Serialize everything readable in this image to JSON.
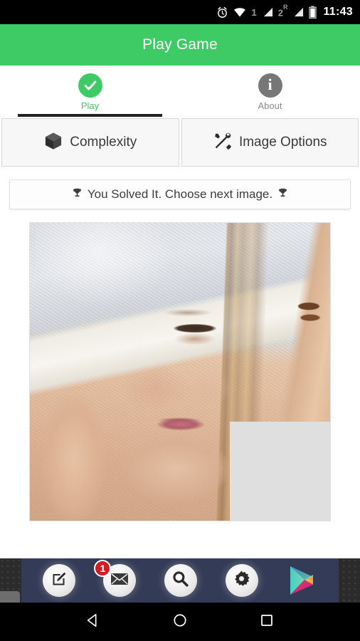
{
  "statusbar": {
    "icons": [
      "alarm-clock-icon",
      "wifi-icon",
      "signal-1-icon",
      "signal-2-roaming-icon",
      "battery-icon"
    ],
    "sim1_label": "1",
    "sim2_label": "2",
    "roaming_label": "R",
    "time": "11:43"
  },
  "appbar": {
    "title": "Play Game"
  },
  "tabs": [
    {
      "label": "Play",
      "icon": "check-circle-icon",
      "selected": true,
      "color": "#3ecb65"
    },
    {
      "label": "About",
      "icon": "info-circle-icon",
      "selected": false,
      "color": "#777777"
    }
  ],
  "options": [
    {
      "label": "Complexity",
      "icon": "cube-icon"
    },
    {
      "label": "Image Options",
      "icon": "tools-icon"
    }
  ],
  "status_card": {
    "text": "You Solved It. Choose next image.",
    "left_icon": "trophy-icon",
    "right_icon": "trophy-icon",
    "trophy_glyph": "🏆"
  },
  "puzzle": {
    "description": "Woman wearing a white knit cap, blonde hair, brown hair tie on raised wrist",
    "grid": {
      "rows": 3,
      "cols": 3
    },
    "empty_tile": {
      "row": 2,
      "col": 2,
      "color": "#dfdfdf"
    }
  },
  "ad": {
    "close_label": "×",
    "icons": [
      {
        "name": "compose-icon",
        "badge": null
      },
      {
        "name": "mail-icon",
        "badge": "1"
      },
      {
        "name": "search-icon",
        "badge": null
      },
      {
        "name": "settings-gear-icon",
        "badge": null
      }
    ],
    "store_icon": "google-play-icon",
    "background_color": "#343b56"
  },
  "navbar": {
    "buttons": [
      {
        "name": "back-button",
        "icon": "triangle-left-icon"
      },
      {
        "name": "home-button",
        "icon": "circle-icon"
      },
      {
        "name": "recents-button",
        "icon": "square-icon"
      }
    ]
  },
  "colors": {
    "accent_green": "#3ecb65",
    "statusbar": "#000000",
    "tab_inactive": "#777777",
    "badge_red": "#cf1d23"
  }
}
